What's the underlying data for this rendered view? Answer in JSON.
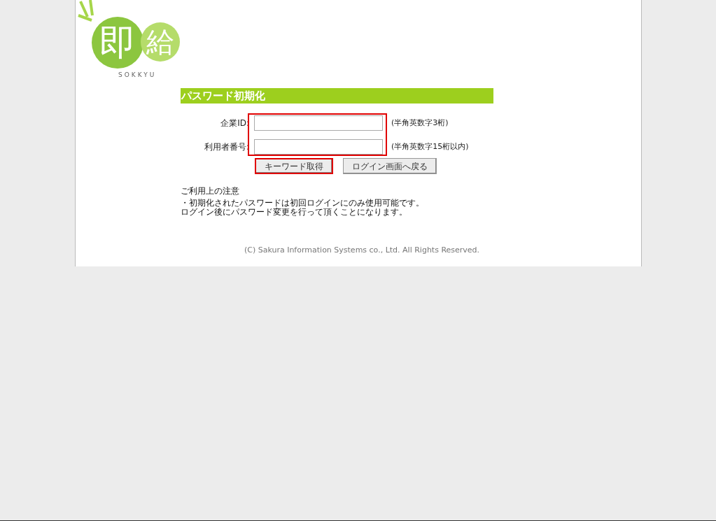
{
  "logo": {
    "mark": "即",
    "word": "給",
    "caption": "SOKKYU"
  },
  "title": "パスワード初期化",
  "fields": [
    {
      "label": "企業ID:",
      "hint": "(半角英数字3桁)"
    },
    {
      "label": "利用者番号:",
      "hint": "(半角英数字15桁以内)"
    }
  ],
  "buttons": [
    {
      "label": "キーワード取得",
      "highlighted": true
    },
    {
      "label": "ログイン画面へ戻る",
      "highlighted": false
    }
  ],
  "notes": {
    "heading": "ご利用上の注意",
    "lines": [
      "・初期化されたパスワードは初回ログインにのみ使用可能です。",
      "ログイン後にパスワード変更を行って頂くことになります。"
    ]
  },
  "footer": "(C) Sakura Information Systems co., Ltd. All Rights Reserved."
}
